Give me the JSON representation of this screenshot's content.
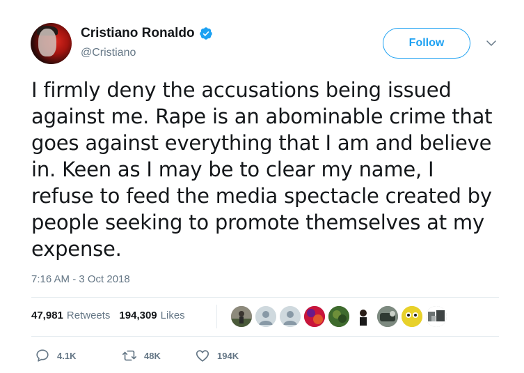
{
  "user": {
    "display_name": "Cristiano Ronaldo",
    "handle": "@Cristiano",
    "verified": true
  },
  "follow_label": "Follow",
  "tweet": {
    "text": "I firmly deny the accusations being issued against me. Rape is an abominable crime that goes against everything that I am and believe in. Keen as I may be to clear my name, I refuse to feed the media spectacle created by people seeking to promote themselves at my expense.",
    "lines": [
      "I firmly deny the accusations being issued",
      "against me. Rape is an abominable crime that",
      "goes against everything that I am and believe",
      "in. Keen as I may be to clear my name, I",
      "refuse to feed the media spectacle created by",
      "people seeking to promote themselves at my",
      "expense."
    ],
    "timestamp": "7:16 AM - 3 Oct 2018"
  },
  "stats": {
    "retweets_count": "47,981",
    "retweets_label": "Retweets",
    "likes_count": "194,309",
    "likes_label": "Likes"
  },
  "actions": {
    "reply_count": "4.1K",
    "retweet_count": "48K",
    "like_count": "194K"
  },
  "colors": {
    "accent": "#1da1f2",
    "muted": "#657786",
    "text": "#14171a",
    "divider": "#e6ecf0"
  },
  "liker_avatars": [
    {
      "icon": "user-photo-icon",
      "bg": "#6f6a5e"
    },
    {
      "icon": "default-user-icon",
      "bg": "#cfd9de"
    },
    {
      "icon": "default-user-icon",
      "bg": "#cfd9de"
    },
    {
      "icon": "user-photo-icon",
      "bg": "#b0204a"
    },
    {
      "icon": "user-photo-icon",
      "bg": "#3f6b2e"
    },
    {
      "icon": "user-photo-icon",
      "bg": "#ffffff"
    },
    {
      "icon": "user-photo-icon",
      "bg": "#5a6a5a"
    },
    {
      "icon": "user-photo-icon",
      "bg": "#e2c82a"
    },
    {
      "icon": "user-photo-icon",
      "bg": "#9aa0a0"
    }
  ]
}
